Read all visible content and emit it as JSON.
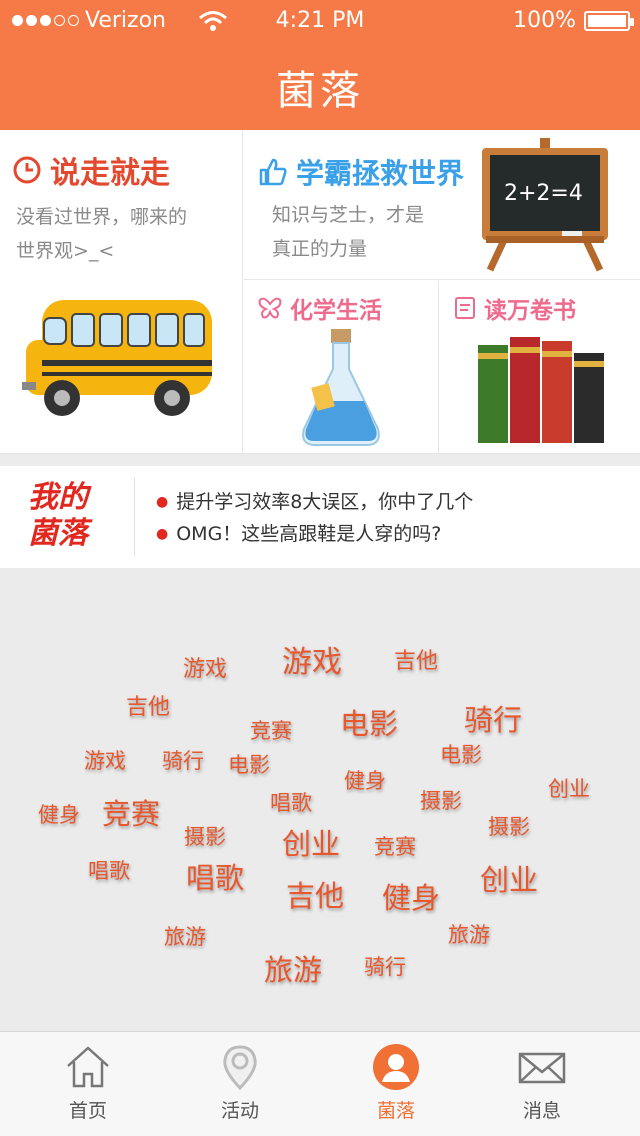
{
  "status_bar": {
    "carrier": "Verizon",
    "time": "4:21 PM",
    "battery": "100%"
  },
  "header": {
    "title": "菌落"
  },
  "features": {
    "card1": {
      "title": "说走就走",
      "line1": "没看过世界，哪来的",
      "line2": "世界观>_<",
      "icon": "clock-icon",
      "color": "#e2492f"
    },
    "card2": {
      "title": "学霸拯救世界",
      "line1": "知识与芝士，才是",
      "line2": "真正的力量",
      "icon": "thumbs-up-icon",
      "color": "#3aa0e8"
    },
    "card3": {
      "title": "化学生活",
      "icon": "butterfly-icon",
      "color": "#ef6b8e"
    },
    "card4": {
      "title": "读万卷书",
      "icon": "document-icon",
      "color": "#ef6b8e"
    }
  },
  "announcement": {
    "logo_line1": "我的",
    "logo_line2": "菌落",
    "items": [
      "提升学习效率8大误区，你中了几个",
      "OMG！这些高跟鞋是人穿的吗?"
    ]
  },
  "tag_cloud": [
    "游戏",
    "游戏",
    "吉他",
    "吉他",
    "竞赛",
    "电影",
    "骑行",
    "游戏",
    "骑行",
    "电影",
    "电影",
    "健身",
    "创业",
    "唱歌",
    "摄影",
    "健身",
    "竞赛",
    "摄影",
    "摄影",
    "创业",
    "竞赛",
    "唱歌",
    "唱歌",
    "吉他",
    "健身",
    "创业",
    "旅游",
    "旅游",
    "旅游",
    "骑行"
  ],
  "tabbar": {
    "tabs": [
      {
        "label": "首页",
        "icon": "home-icon"
      },
      {
        "label": "活动",
        "icon": "location-icon"
      },
      {
        "label": "菌落",
        "icon": "user-icon"
      },
      {
        "label": "消息",
        "icon": "mail-icon"
      }
    ],
    "active_color": "#f07035"
  }
}
